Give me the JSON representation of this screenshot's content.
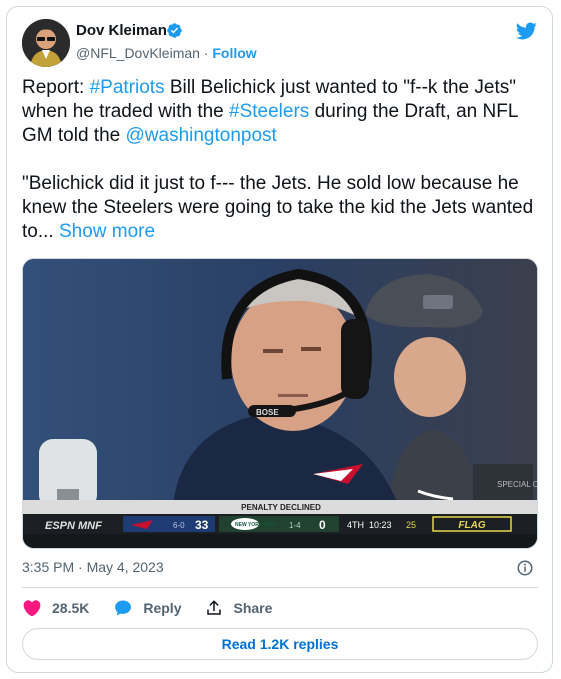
{
  "author": {
    "name": "Dov Kleiman",
    "handle": "@NFL_DovKleiman",
    "separator": " · ",
    "follow_label": "Follow"
  },
  "tweet": {
    "p1_a": "Report: ",
    "p1_hashtag1": "#Patriots",
    "p1_b": " Bill Belichick just wanted to \"f--k the Jets\" when he traded with the ",
    "p1_hashtag2": "#Steelers",
    "p1_c": " during the Draft, an NFL GM told the ",
    "p1_mention": "@washingtonpost",
    "p2_text": "\"Belichick did it just to f--- the Jets. He sold low because he knew the Steelers were going to take the kid the Jets wanted to... ",
    "show_more": "Show more"
  },
  "media": {
    "headset_brand": "BOSE",
    "hat_text": "SPECIAL OPS",
    "banner": "PENALTY DECLINED",
    "network": "ESPN MNF",
    "team1_record": "6-0",
    "team1_score": "33",
    "team2_logo_text": "NEW YORK JETS",
    "team2_record": "1-4",
    "team2_score": "0",
    "quarter": "4TH",
    "clock": "10:23",
    "play_clock": "25",
    "flag": "FLAG"
  },
  "timestamp": "3:35 PM · May 4, 2023",
  "actions": {
    "likes": "28.5K",
    "reply_label": "Reply",
    "share_label": "Share"
  },
  "read_replies": "Read 1.2K replies",
  "colors": {
    "link": "#1d9bf0",
    "like": "#f91880",
    "secondary_text": "#536471",
    "border": "#cfd9de"
  },
  "icons": [
    "verified-badge-icon",
    "twitter-bird-icon",
    "info-icon",
    "heart-icon",
    "reply-bubble-icon",
    "share-icon"
  ]
}
